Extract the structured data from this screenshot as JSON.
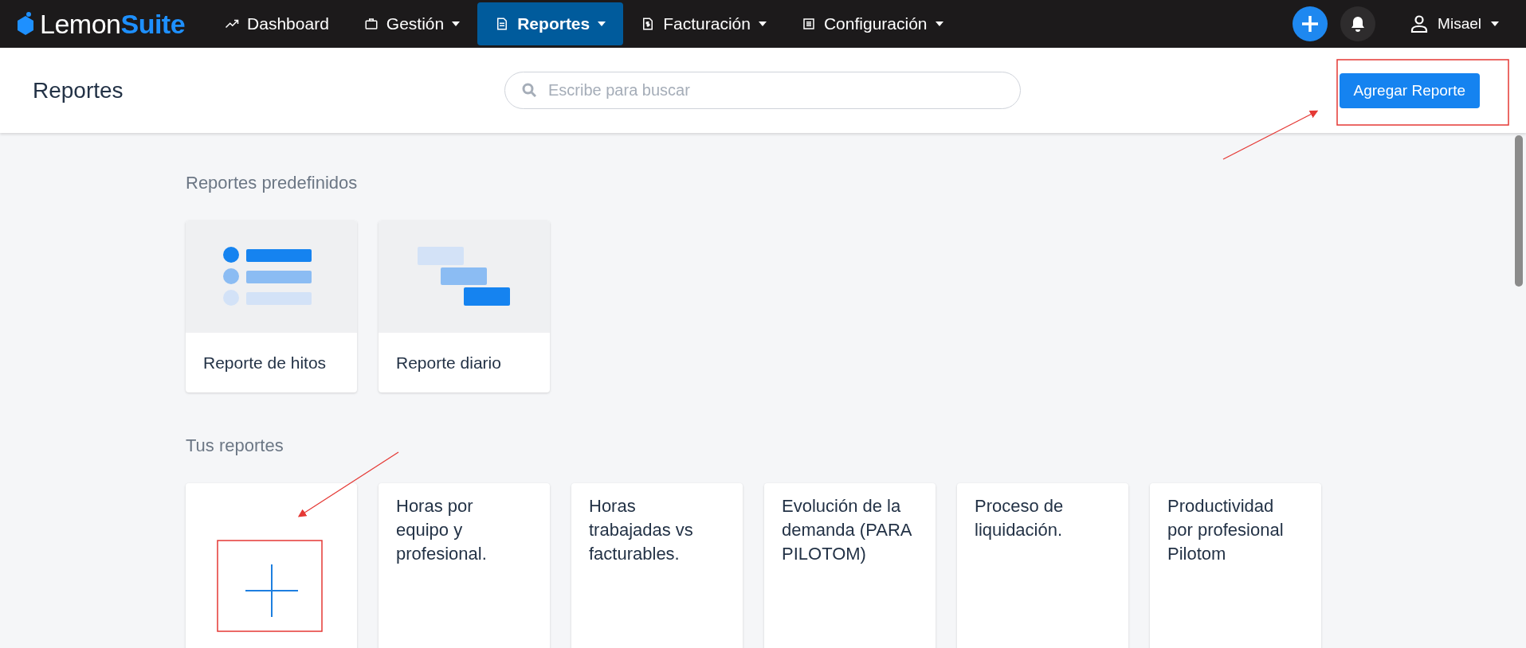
{
  "logo": {
    "first": "Lemon",
    "second": "Suite"
  },
  "nav": [
    {
      "label": "Dashboard",
      "dropdown": false,
      "selected": false
    },
    {
      "label": "Gestión",
      "dropdown": true,
      "selected": false
    },
    {
      "label": "Reportes",
      "dropdown": true,
      "selected": true
    },
    {
      "label": "Facturación",
      "dropdown": true,
      "selected": false
    },
    {
      "label": "Configuración",
      "dropdown": true,
      "selected": false
    }
  ],
  "user": {
    "name": "Misael"
  },
  "header": {
    "title": "Reportes",
    "search": {
      "placeholder": "Escribe para buscar"
    },
    "button": "Agregar Reporte"
  },
  "predefined": {
    "heading": "Reportes predefinidos",
    "cards": [
      {
        "title": "Reporte de hitos",
        "kind": "list"
      },
      {
        "title": "Reporte diario",
        "kind": "gantt"
      }
    ]
  },
  "custom": {
    "heading": "Tus reportes",
    "cards": [
      {
        "kind": "add"
      },
      {
        "kind": "report",
        "title": "Horas por equipo y profesional."
      },
      {
        "kind": "report",
        "title": "Horas trabajadas vs facturables."
      },
      {
        "kind": "report",
        "title": "Evolución de la demanda (PARA PILOTOM)"
      },
      {
        "kind": "report",
        "title": "Proceso de liquidación."
      },
      {
        "kind": "report",
        "title": "Productividad por profesional Pilotom"
      }
    ]
  }
}
